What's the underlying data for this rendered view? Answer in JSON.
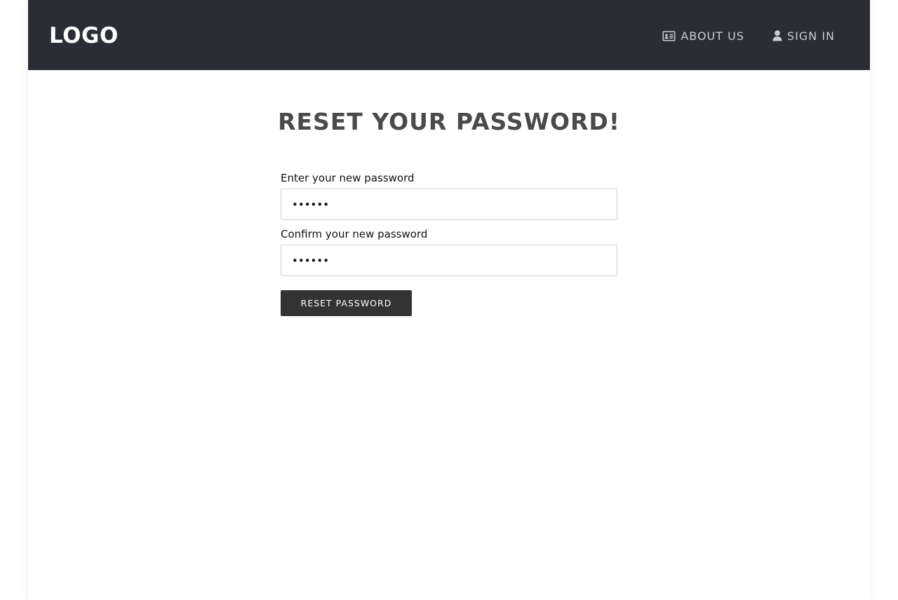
{
  "navbar": {
    "logo": "LOGO",
    "links": [
      {
        "label": "ABOUT US",
        "icon": "id-card-icon"
      },
      {
        "label": "SIGN IN",
        "icon": "user-icon"
      }
    ]
  },
  "main": {
    "title": "RESET YOUR PASSWORD!",
    "form": {
      "new_password_label": "Enter your new password",
      "new_password_value": "••••••",
      "confirm_password_label": "Confirm your new password",
      "confirm_password_value": "••••••",
      "submit_label": "RESET PASSWORD"
    }
  },
  "colors": {
    "navbar_bg": "#2b2d35",
    "title": "#4a4a4a",
    "button_bg": "#333333"
  }
}
